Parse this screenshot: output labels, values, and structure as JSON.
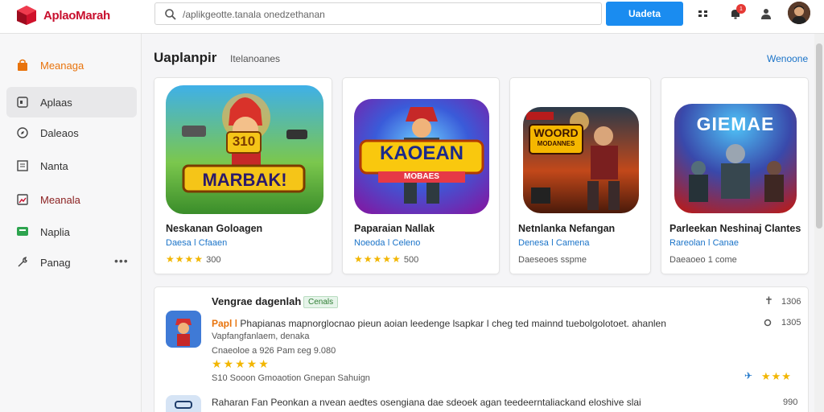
{
  "header": {
    "app_title": "AplaoMarah",
    "search_placeholder": "/aplikgeotte.tanala onedzethanan",
    "primary_button": "Uadeta",
    "notif_count": "1",
    "icons": [
      "grid-icon",
      "bell-icon",
      "user-icon"
    ]
  },
  "sidebar": {
    "items": [
      {
        "label": "Meanaga",
        "icon": "bag-icon"
      },
      {
        "label": "Aplaas",
        "icon": "apps-icon"
      },
      {
        "label": "Daleaos",
        "icon": "compass-icon"
      },
      {
        "label": "Nanta",
        "icon": "document-icon"
      },
      {
        "label": "Meanala",
        "icon": "image-icon"
      },
      {
        "label": "Naplia",
        "icon": "chat-icon"
      },
      {
        "label": "Panag",
        "icon": "wrench-icon",
        "more": "•••"
      }
    ]
  },
  "section": {
    "title": "Uaplanpir",
    "subtitle": "Itelanoanes",
    "link": "Wenoone"
  },
  "cards": [
    {
      "title": "Neskanan Goloagen",
      "meta": "Daesa ǀ Cfaaen",
      "stars": "★★★★",
      "rating": "300",
      "art_text": "MARBAK!",
      "art_badge": "310"
    },
    {
      "title": "Paparaian Nallak",
      "meta": "Noeoda ǀ Celeno",
      "stars": "★★★★★",
      "rating": "500",
      "art_text": "KAOEAN",
      "art_badge": "MOBAES"
    },
    {
      "title": "Netnlanka Nefangan",
      "meta": "Denesa ǀ Camena",
      "stars": "",
      "rating": "Daeseoes sspme",
      "art_text": "WOORD",
      "art_badge": "MODANNES"
    },
    {
      "title": "Parleekan Neshinaj Clantes",
      "meta": "Rareolan ǀ Canae",
      "stars": "",
      "rating": "Daeaoeo 1 come",
      "art_text": "GIEMAE",
      "art_badge": ""
    }
  ],
  "list": {
    "title": "Vengrae dagenlah",
    "tag": "Cenals",
    "rows": [
      {
        "title_prefix": "Papl ǀ",
        "text": "Phapianas mapnorglocnao pieun aoian leedenge lsapkar ǀ cheg ted mainnd tuebolgolotoet. ahanlen",
        "subtext": "Vapfangfanlaem, denaka",
        "meta": "Cnaeoloe a   926 Pam   ɛeg 9.080",
        "stars": "★★★★★",
        "tags": "S10 Sooon    Gmoaotion    Gnepan    Sahuign",
        "right_top": "1306",
        "right_mid": "1305",
        "right_stars": "★★★"
      },
      {
        "text": "Raharan Fan Peonkan a nvean aedtes osengiana dae sdeoek agan teedeerntaliackand eloshive slai",
        "right_top": "990"
      }
    ]
  },
  "colors": {
    "accent": "#1a8cf0",
    "brand": "#c8102e",
    "sidebar_accent": "#e8730c",
    "link": "#1a73c8",
    "star": "#f2b600"
  }
}
